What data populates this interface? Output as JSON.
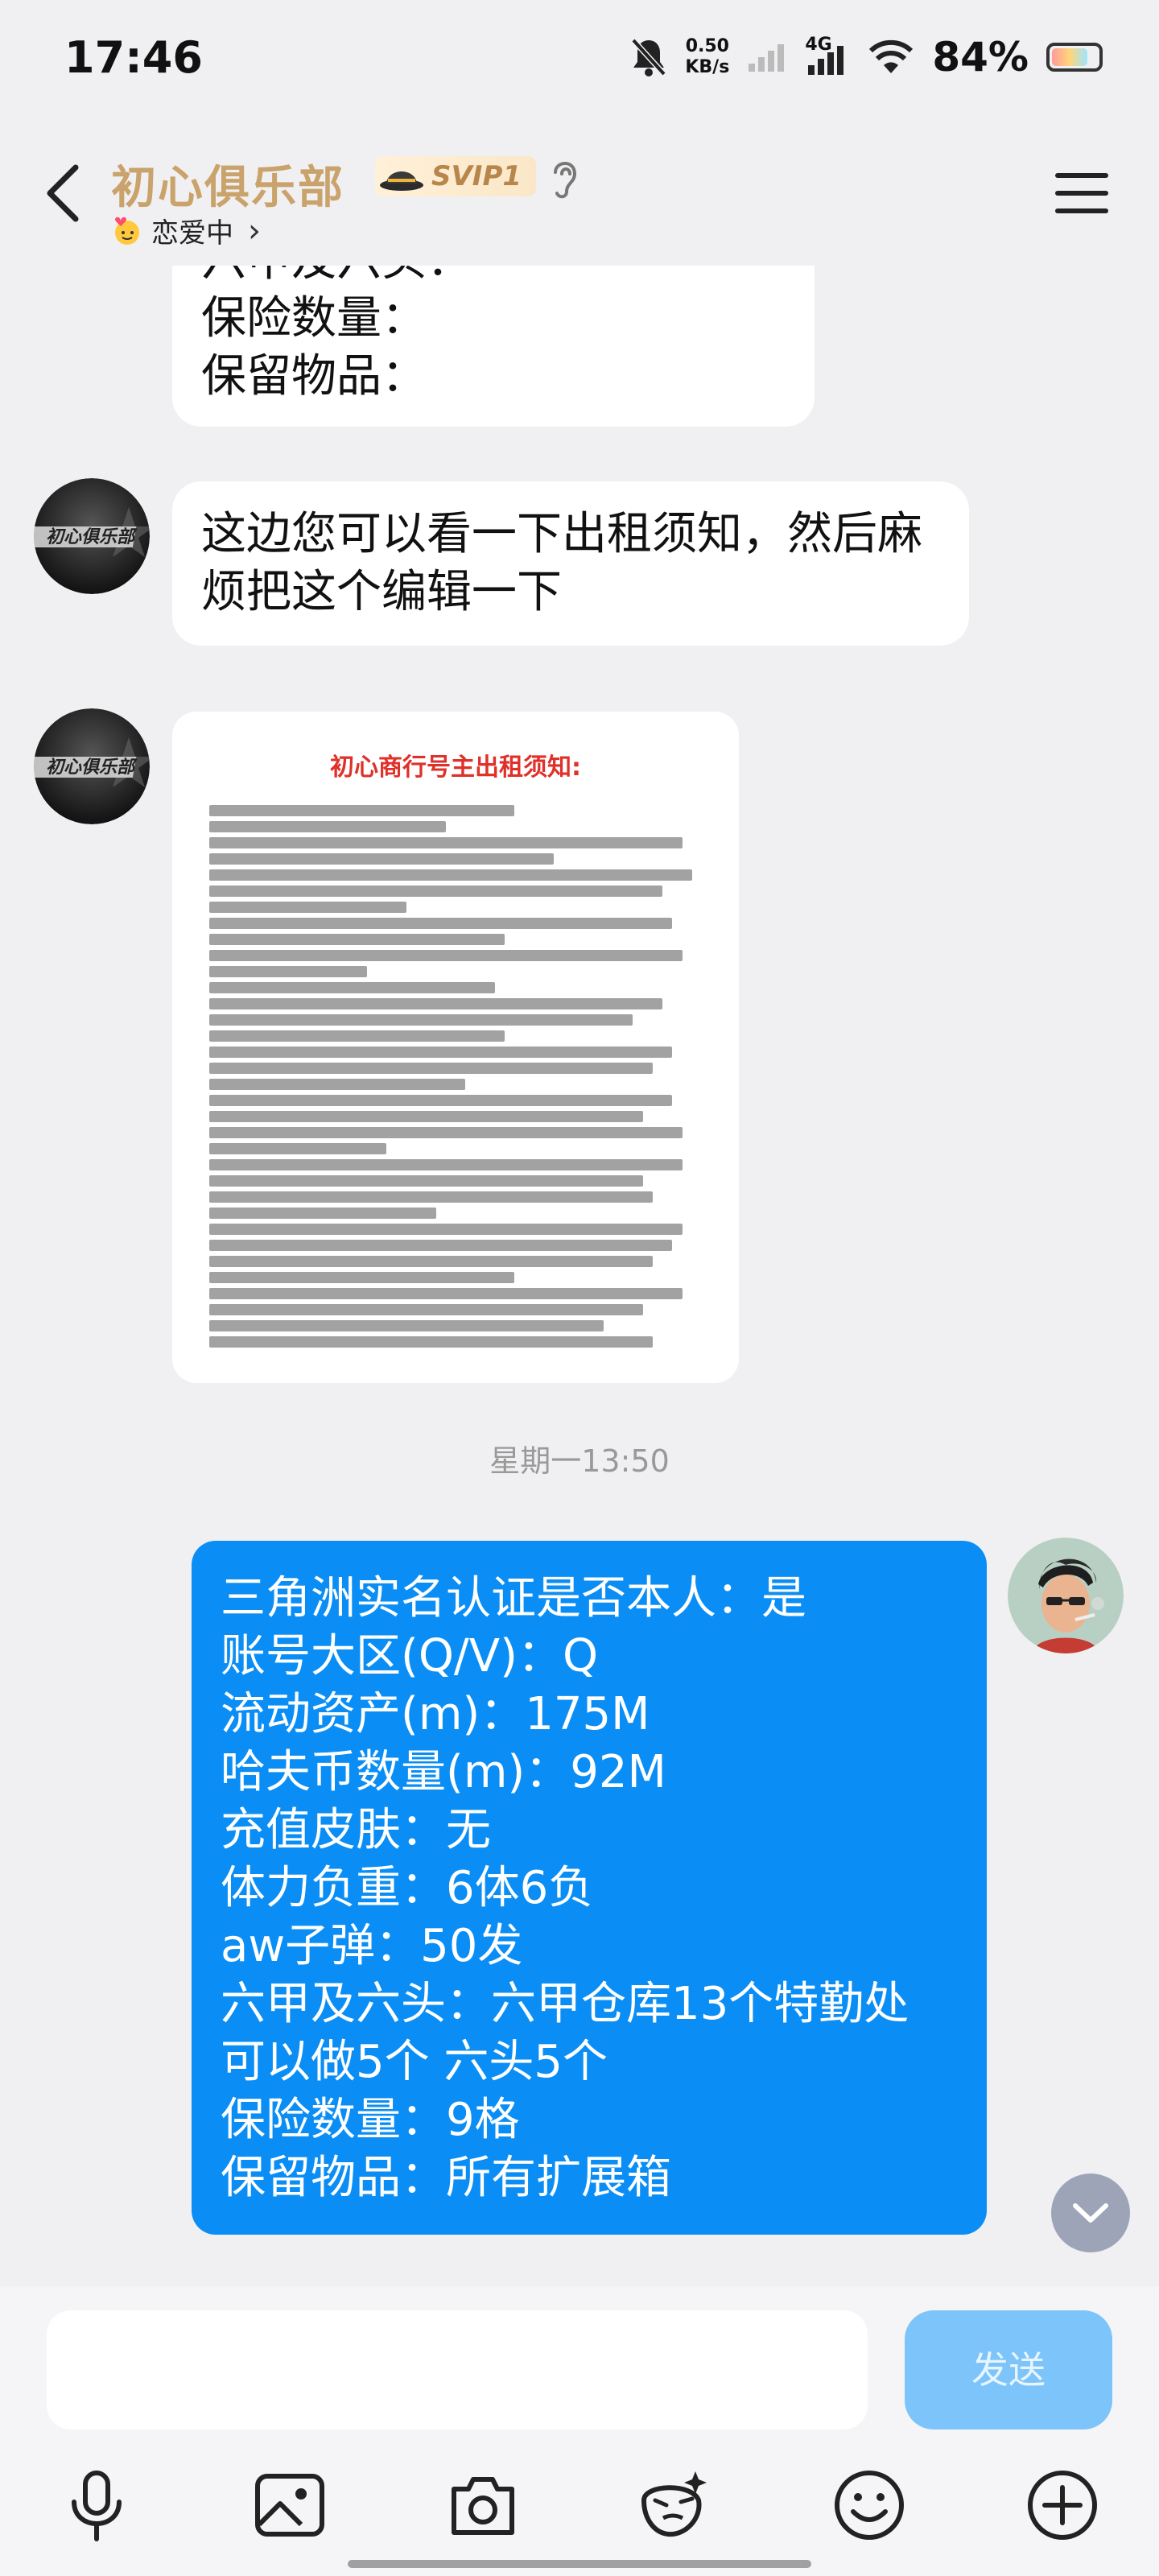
{
  "status_bar": {
    "time": "17:46",
    "speed_value": "0.50",
    "speed_unit": "KB/s",
    "network": "4G",
    "battery": "84%"
  },
  "header": {
    "title": "初心俱乐部",
    "badge": "SVIP1",
    "subtitle": "恋爱中",
    "subtitle_arrow": "›"
  },
  "messages": {
    "partial_lines": [
      "六甲及六头：",
      "保险数量：",
      "保留物品："
    ],
    "msg2": "这边您可以看一下出租须知，然后麻烦把这个编辑一下",
    "image_title": "初心商行号主出租须知:",
    "timestamp": "星期一13:50",
    "my_lines": [
      "三角洲实名认证是否本人：是",
      "账号大区(Q/V)：Q",
      "流动资产(m)：175M",
      "哈夫币数量(m)：92M",
      "充值皮肤：无",
      "体力负重：6体6负",
      "aw子弹：50发",
      "六甲及六头：六甲仓库13个特勤处",
      "可以做5个 六头5个",
      "保险数量：9格",
      "保留物品：所有扩展箱"
    ]
  },
  "input": {
    "send_label": "发送"
  },
  "colors": {
    "my_bubble": "#0a8ef5",
    "title_gold": "#c9a36b",
    "send_button": "#7cc4fa"
  },
  "icons": [
    "mic-icon",
    "image-icon",
    "camera-icon",
    "sticker-icon",
    "emoji-icon",
    "plus-icon"
  ]
}
